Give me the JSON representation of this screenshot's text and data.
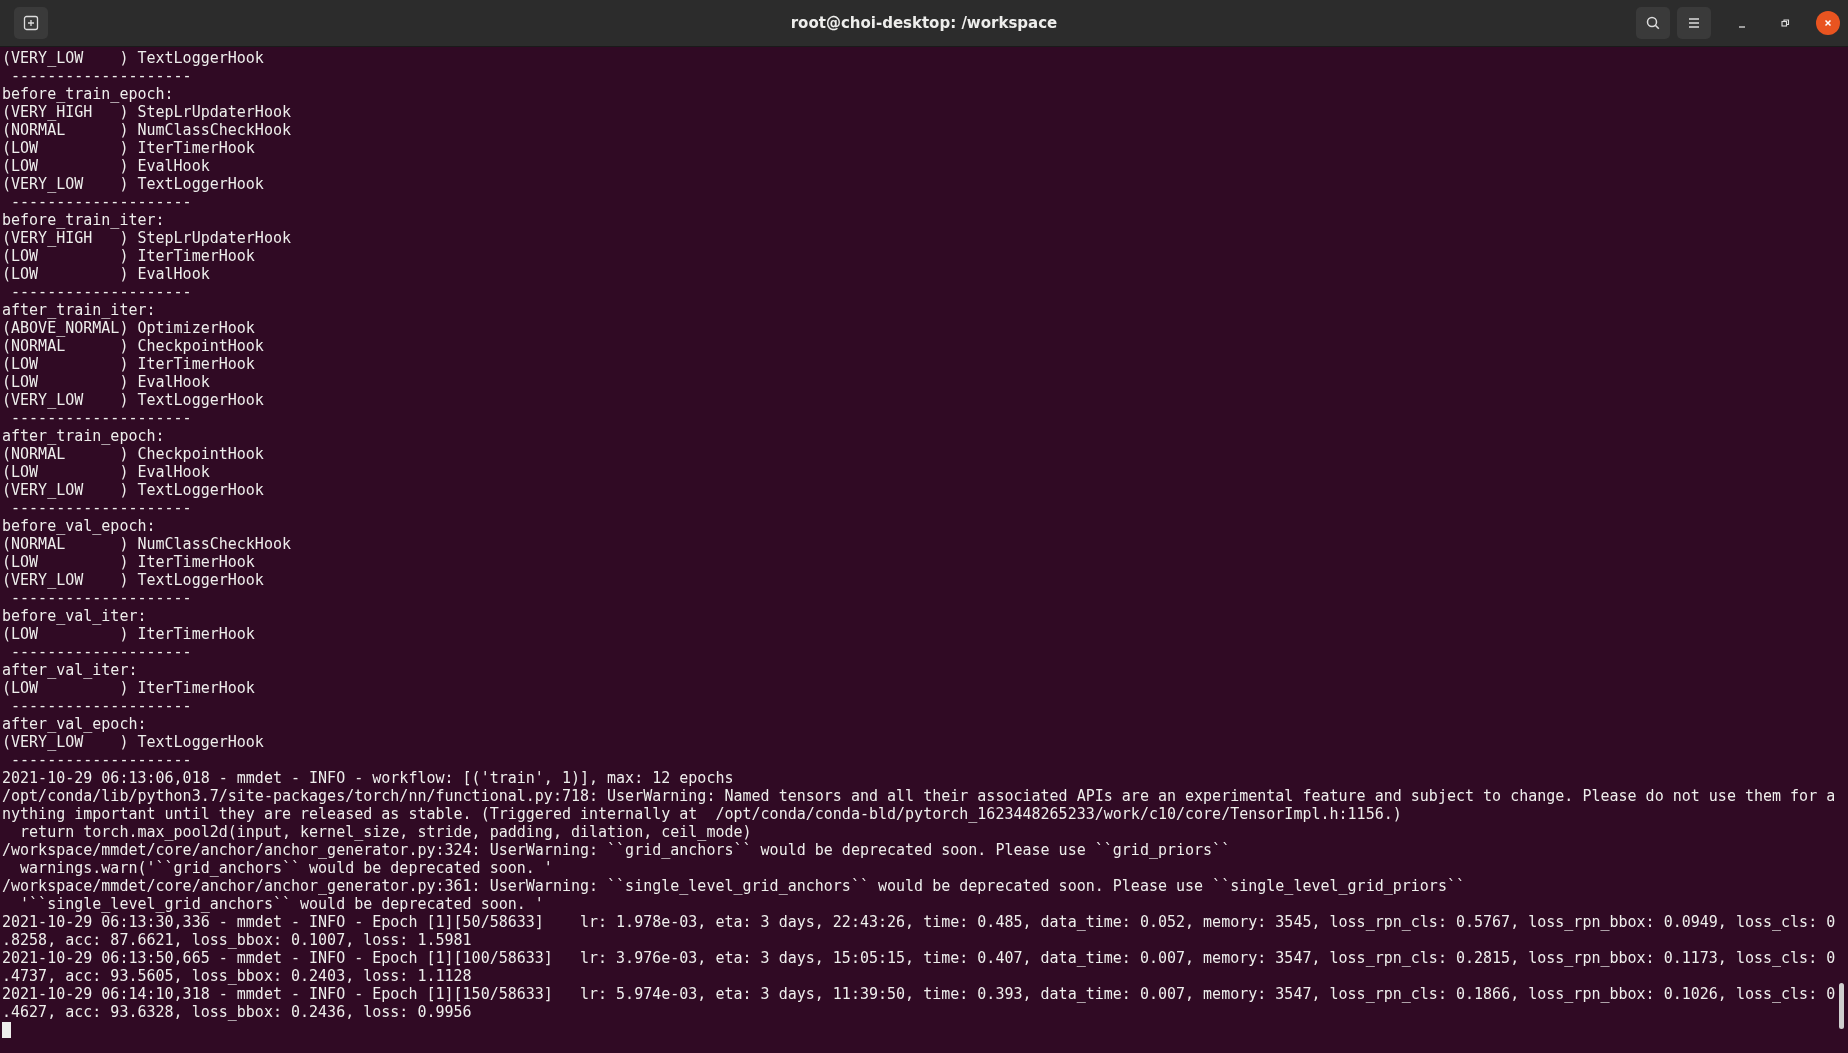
{
  "window": {
    "title": "root@choi-desktop: /workspace"
  },
  "terminal": {
    "lines": [
      "(VERY_LOW    ) TextLoggerHook",
      " --------------------",
      "before_train_epoch:",
      "(VERY_HIGH   ) StepLrUpdaterHook",
      "(NORMAL      ) NumClassCheckHook",
      "(LOW         ) IterTimerHook",
      "(LOW         ) EvalHook",
      "(VERY_LOW    ) TextLoggerHook",
      " --------------------",
      "before_train_iter:",
      "(VERY_HIGH   ) StepLrUpdaterHook",
      "(LOW         ) IterTimerHook",
      "(LOW         ) EvalHook",
      " --------------------",
      "after_train_iter:",
      "(ABOVE_NORMAL) OptimizerHook",
      "(NORMAL      ) CheckpointHook",
      "(LOW         ) IterTimerHook",
      "(LOW         ) EvalHook",
      "(VERY_LOW    ) TextLoggerHook",
      " --------------------",
      "after_train_epoch:",
      "(NORMAL      ) CheckpointHook",
      "(LOW         ) EvalHook",
      "(VERY_LOW    ) TextLoggerHook",
      " --------------------",
      "before_val_epoch:",
      "(NORMAL      ) NumClassCheckHook",
      "(LOW         ) IterTimerHook",
      "(VERY_LOW    ) TextLoggerHook",
      " --------------------",
      "before_val_iter:",
      "(LOW         ) IterTimerHook",
      " --------------------",
      "after_val_iter:",
      "(LOW         ) IterTimerHook",
      " --------------------",
      "after_val_epoch:",
      "(VERY_LOW    ) TextLoggerHook",
      " --------------------",
      "2021-10-29 06:13:06,018 - mmdet - INFO - workflow: [('train', 1)], max: 12 epochs",
      "/opt/conda/lib/python3.7/site-packages/torch/nn/functional.py:718: UserWarning: Named tensors and all their associated APIs are an experimental feature and subject to change. Please do not use them for a",
      "nything important until they are released as stable. (Triggered internally at  /opt/conda/conda-bld/pytorch_1623448265233/work/c10/core/TensorImpl.h:1156.)",
      "  return torch.max_pool2d(input, kernel_size, stride, padding, dilation, ceil_mode)",
      "/workspace/mmdet/core/anchor/anchor_generator.py:324: UserWarning: ``grid_anchors`` would be deprecated soon. Please use ``grid_priors``",
      "  warnings.warn('``grid_anchors`` would be deprecated soon. '",
      "/workspace/mmdet/core/anchor/anchor_generator.py:361: UserWarning: ``single_level_grid_anchors`` would be deprecated soon. Please use ``single_level_grid_priors``",
      "  '``single_level_grid_anchors`` would be deprecated soon. '",
      "2021-10-29 06:13:30,336 - mmdet - INFO - Epoch [1][50/58633]    lr: 1.978e-03, eta: 3 days, 22:43:26, time: 0.485, data_time: 0.052, memory: 3545, loss_rpn_cls: 0.5767, loss_rpn_bbox: 0.0949, loss_cls: 0",
      ".8258, acc: 87.6621, loss_bbox: 0.1007, loss: 1.5981",
      "2021-10-29 06:13:50,665 - mmdet - INFO - Epoch [1][100/58633]   lr: 3.976e-03, eta: 3 days, 15:05:15, time: 0.407, data_time: 0.007, memory: 3547, loss_rpn_cls: 0.2815, loss_rpn_bbox: 0.1173, loss_cls: 0",
      ".4737, acc: 93.5605, loss_bbox: 0.2403, loss: 1.1128",
      "2021-10-29 06:14:10,318 - mmdet - INFO - Epoch [1][150/58633]   lr: 5.974e-03, eta: 3 days, 11:39:50, time: 0.393, data_time: 0.007, memory: 3547, loss_rpn_cls: 0.1866, loss_rpn_bbox: 0.1026, loss_cls: 0",
      ".4627, acc: 93.6328, loss_bbox: 0.2436, loss: 0.9956"
    ]
  }
}
